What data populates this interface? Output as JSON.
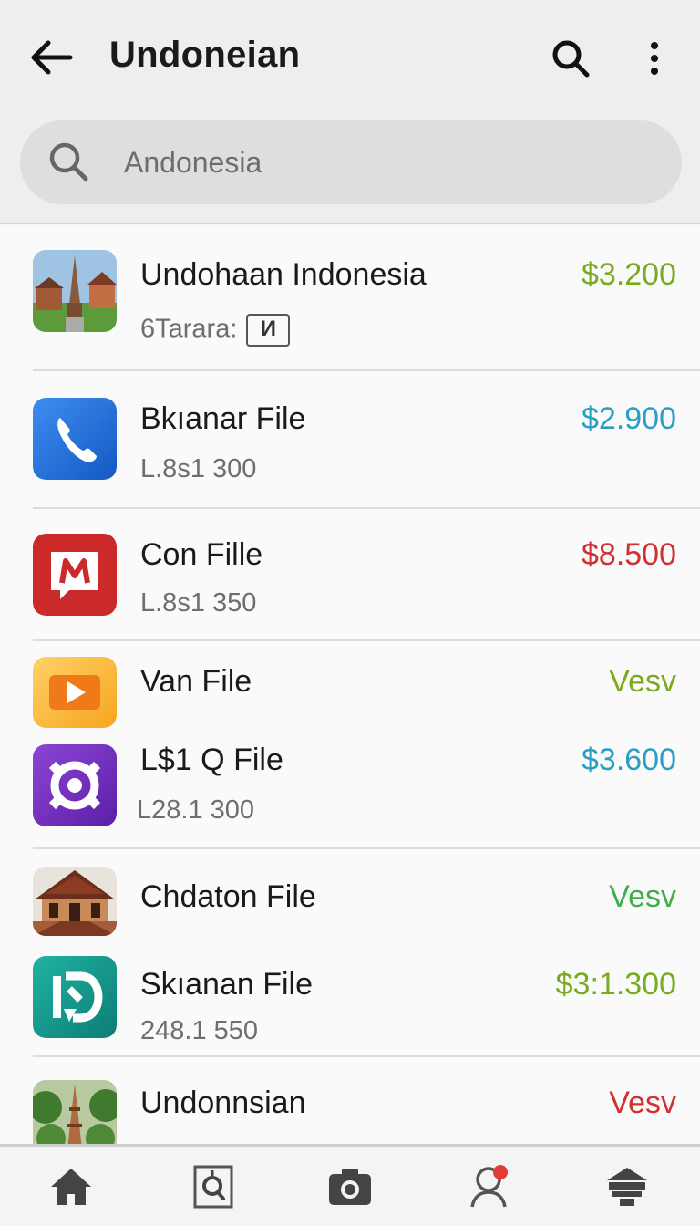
{
  "app_bar": {
    "title": "Undoneian"
  },
  "search": {
    "placeholder": "Andonesia"
  },
  "items": [
    {
      "title": "Undohaan Indonesia",
      "subtitle": "6Tarara:",
      "badge": "И",
      "price": "$3.200",
      "price_color": "#7aaa1e",
      "icon": "temple-photo-icon"
    },
    {
      "title": "Bkıanar File",
      "subtitle": "L.8s1 300",
      "price": "$2.900",
      "price_color": "#2a9fc4",
      "icon": "phone-icon"
    },
    {
      "title": "Con Fille",
      "subtitle": "L.8s1 350",
      "price": "$8.500",
      "price_color": "#d13030",
      "icon": "message-icon"
    },
    {
      "title": "Van File",
      "subtitle": "",
      "price": "Vesv",
      "price_color": "#7aaa1e",
      "icon": "play-icon"
    },
    {
      "title": "L$1 Q File",
      "subtitle": "L28.1 300",
      "price": "$3.600",
      "price_color": "#2a9fc4",
      "icon": "gear-icon"
    },
    {
      "title": "Chdaton File",
      "subtitle": "",
      "price": "Vesv",
      "price_color": "#3fae4a",
      "icon": "house-photo-icon"
    },
    {
      "title": "Skıanan File",
      "subtitle": "248.1 550",
      "price": "$3:1.300",
      "price_color": "#7aaa1e",
      "icon": "refresh-icon"
    },
    {
      "title": "Undonnsian",
      "subtitle": "",
      "price": "Vesv",
      "price_color": "#d13030",
      "icon": "pagoda-photo-icon"
    }
  ],
  "bottom_nav": [
    {
      "name": "home",
      "icon": "home-icon"
    },
    {
      "name": "search",
      "icon": "search-doc-icon"
    },
    {
      "name": "camera",
      "icon": "camera-icon"
    },
    {
      "name": "profile",
      "icon": "profile-icon",
      "notification": true
    },
    {
      "name": "storefront",
      "icon": "store-icon"
    }
  ]
}
